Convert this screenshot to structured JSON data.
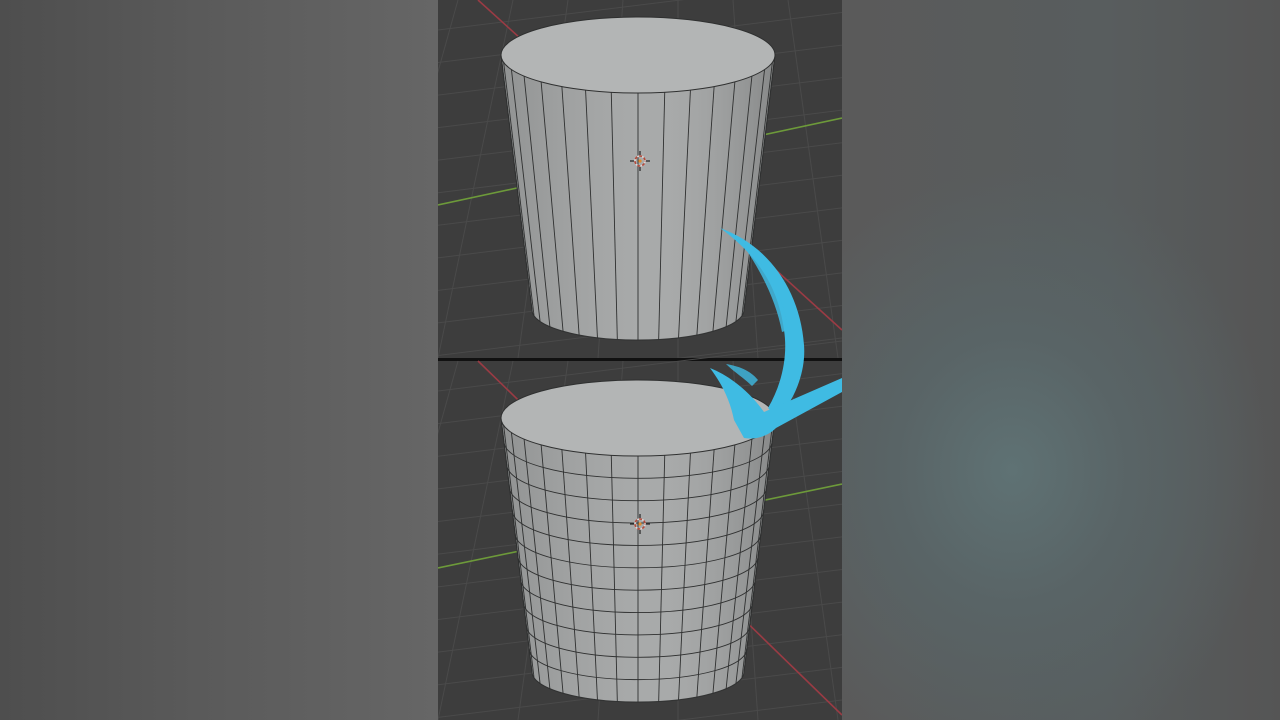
{
  "video_frame": {
    "theme": {
      "viewport_bg": "#3d3d3d",
      "grid_line": "#4a4a4a",
      "x_axis": "#9a3b44",
      "y_axis": "#6d9a3a",
      "mesh_fill": "#a4a6a6",
      "mesh_top": "#b3b5b5",
      "wire": "#2f3030",
      "arrow": "#3fbbe3",
      "side_bg": "#5a5a5a"
    },
    "panels": [
      {
        "name": "viewport-before",
        "object": "cylinder",
        "vertical_segments": 16,
        "horizontal_loops": 0
      },
      {
        "name": "viewport-after",
        "object": "cylinder",
        "vertical_segments": 16,
        "horizontal_loops": 10
      }
    ],
    "overlay": {
      "icon": "curved-arrow-icon",
      "direction": "down"
    }
  }
}
